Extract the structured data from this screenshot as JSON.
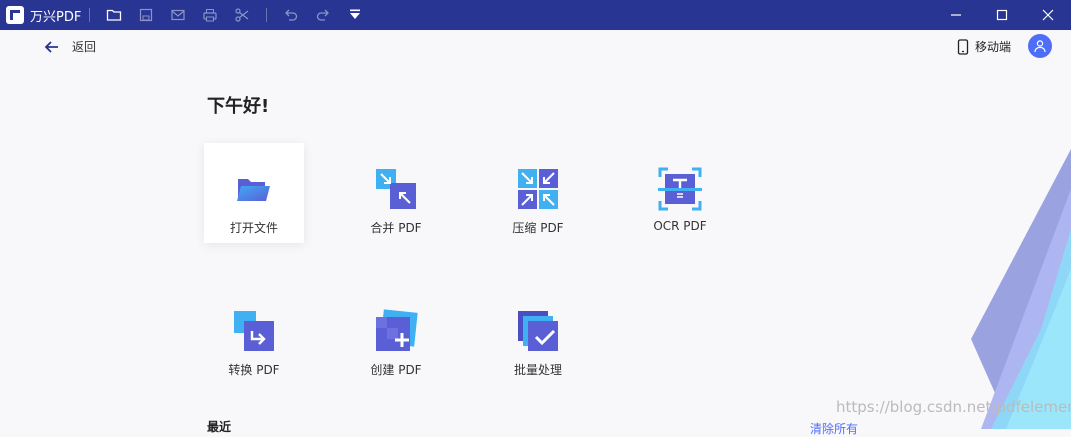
{
  "titlebar": {
    "app_name": "万兴PDF",
    "icons": [
      "folder-icon",
      "save-icon",
      "mail-icon",
      "print-icon",
      "scissors-icon",
      "undo-icon",
      "redo-icon",
      "dropdown-icon"
    ],
    "window_controls": [
      "minimize-icon",
      "maximize-icon",
      "close-icon"
    ]
  },
  "nav": {
    "back_label": "返回",
    "mobile_label": "移动端"
  },
  "greeting": "下午好!",
  "tiles": [
    {
      "label": "打开文件",
      "icon": "open-folder-icon"
    },
    {
      "label": "合并 PDF",
      "icon": "merge-icon"
    },
    {
      "label": "压缩 PDF",
      "icon": "compress-icon"
    },
    {
      "label": "OCR PDF",
      "icon": "ocr-icon"
    },
    {
      "label": "转换 PDF",
      "icon": "convert-icon"
    },
    {
      "label": "创建 PDF",
      "icon": "create-icon"
    },
    {
      "label": "批量处理",
      "icon": "batch-icon"
    }
  ],
  "recent": {
    "title": "最近",
    "clear_label": "清除所有"
  },
  "watermark": "https://blog.csdn.net/pdfelement",
  "colors": {
    "titlebar": "#283593",
    "accent": "#4f6ef7",
    "background": "#f8f8fb"
  }
}
